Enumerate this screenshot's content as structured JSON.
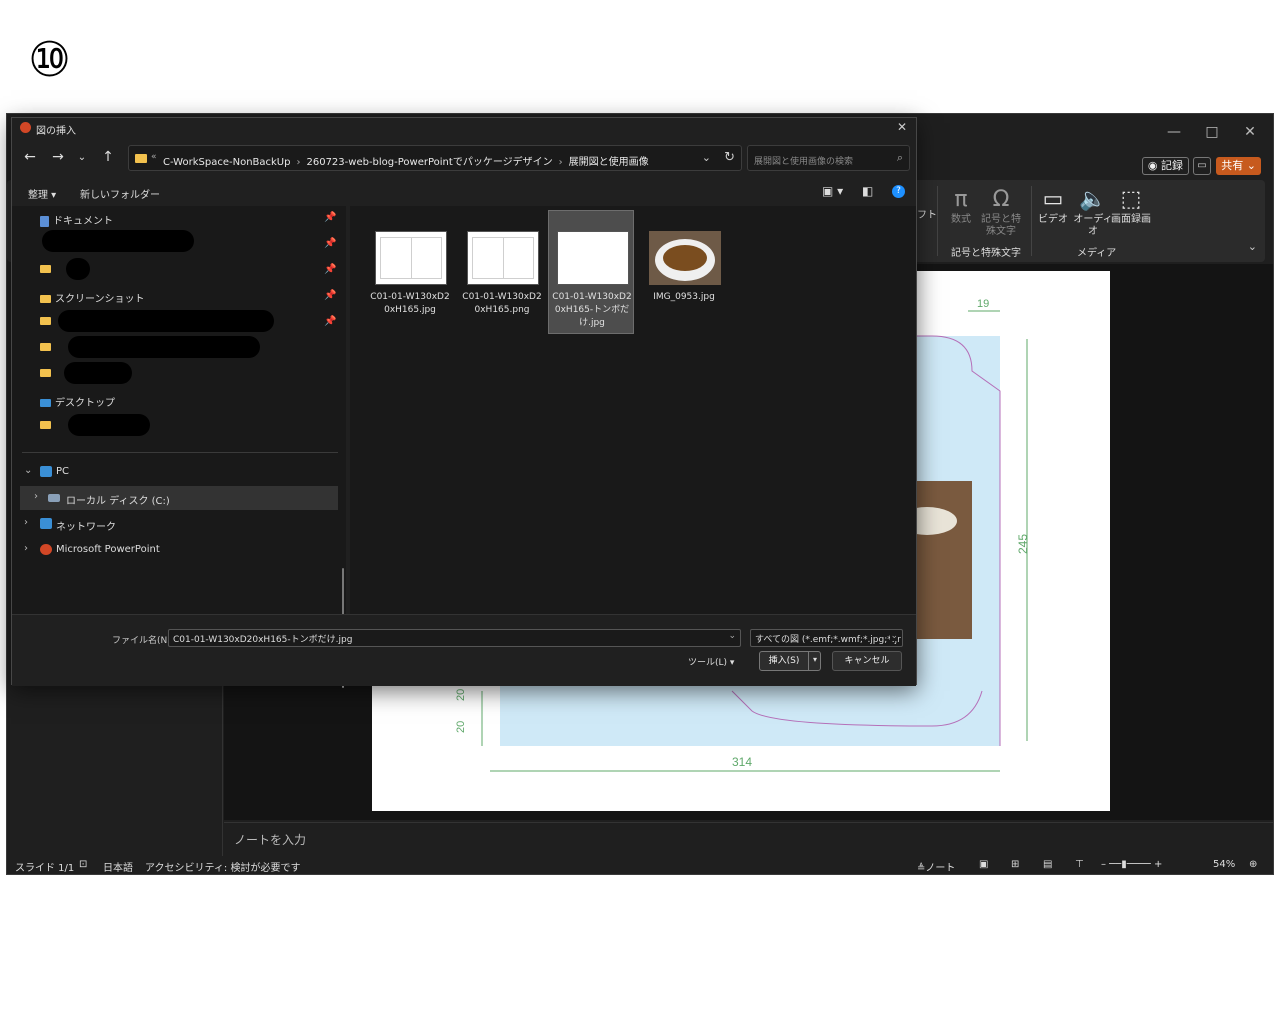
{
  "step_number": "⑩",
  "ppt": {
    "window_controls": {
      "minimize": "—",
      "maximize": "□",
      "close": "✕"
    },
    "record_label": "◉ 記録",
    "share_label": "共有 ⌄",
    "ribbon": {
      "cut_label": "フト",
      "equation": {
        "label": "数式",
        "icon": "π"
      },
      "symbol": {
        "label": "記号と特殊文字",
        "icon": "Ω"
      },
      "video": {
        "label": "ビデオ",
        "icon": "▭"
      },
      "audio": {
        "label": "オーディオ",
        "icon": "🔈"
      },
      "screen_recording": {
        "label": "画面録画",
        "icon": "⬚"
      },
      "group_symbols": "記号と特殊文字",
      "group_media": "メディア"
    },
    "notes_placeholder": "ノートを入力",
    "status": {
      "slide": "スライド 1/1",
      "language": "日本語",
      "accessibility": "アクセシビリティ: 検討が必要です",
      "notes": "≜ノート",
      "zoom": "54%"
    },
    "slide_dimensions": {
      "width_label": "314",
      "height_label": "245",
      "flap_label": "19",
      "bottom_margin_a": "20",
      "bottom_margin_b": "20"
    },
    "colors": {
      "accent": "#c75a1e",
      "panel_blue": "#cfe9f7",
      "dimension_green": "#5fa86a"
    }
  },
  "dialog": {
    "title": "図の挿入",
    "close_icon": "✕",
    "nav": {
      "back": "←",
      "forward": "→",
      "recent": "⌄",
      "up": "↑"
    },
    "breadcrumb": [
      "C-WorkSpace-NonBackUp",
      "260723-web-blog-PowerPointでパッケージデザイン",
      "展開図と使用画像"
    ],
    "search_placeholder": "展開図と使用画像の検索",
    "organize_label": "整理 ▾",
    "new_folder_label": "新しいフォルダー",
    "quick_access": [
      {
        "label": "ドキュメント",
        "pinned": true
      },
      {
        "label": "",
        "pinned": true
      },
      {
        "label": "",
        "pinned": true
      },
      {
        "label": "スクリーンショット",
        "pinned": true
      },
      {
        "label": "",
        "pinned": true
      },
      {
        "label": "",
        "pinned": false
      },
      {
        "label": "",
        "pinned": false
      },
      {
        "label": "デスクトップ",
        "pinned": false
      },
      {
        "label": "",
        "pinned": false
      }
    ],
    "tree": {
      "pc": "PC",
      "local_disk": "ローカル ディスク (C:)",
      "network": "ネットワーク",
      "powerpoint": "Microsoft PowerPoint"
    },
    "files": [
      {
        "name": "C01-01-W130xD20xH165.jpg",
        "thumb": "diagram-two-panel",
        "selected": false
      },
      {
        "name": "C01-01-W130xD20xH165.png",
        "thumb": "diagram-two-panel",
        "selected": false
      },
      {
        "name": "C01-01-W130xD20xH165-トンボだけ.jpg",
        "thumb": "blank-with-marks",
        "selected": true
      },
      {
        "name": "IMG_0953.jpg",
        "thumb": "curry-photo",
        "selected": false
      }
    ],
    "file_name_label": "ファイル名(N):",
    "file_name_value": "C01-01-W130xD20xH165-トンボだけ.jpg",
    "file_type_value": "すべての図 (*.emf;*.wmf;*.jpg;*.jr",
    "tools_label": "ツール(L)",
    "insert_label": "挿入(S)",
    "cancel_label": "キャンセル"
  }
}
